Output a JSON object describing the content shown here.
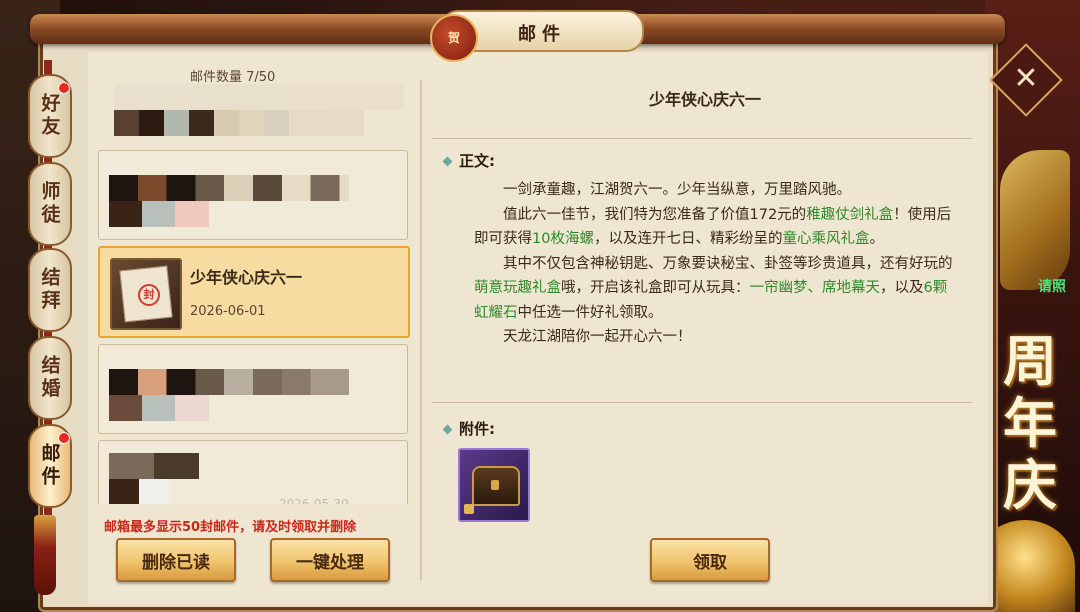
{
  "window": {
    "title": "邮件",
    "seal_text": "贺"
  },
  "scene": {
    "right_text": "请照",
    "anniversary_text": "周年庆"
  },
  "side_tabs": [
    {
      "label": "好友",
      "has_dot": true
    },
    {
      "label": "师徒",
      "has_dot": false
    },
    {
      "label": "结拜",
      "has_dot": false
    },
    {
      "label": "结婚",
      "has_dot": false
    },
    {
      "label": "邮件",
      "has_dot": true,
      "active": true
    }
  ],
  "mail_list": {
    "count_label": "邮件数量 7/50",
    "items": [
      {
        "title": "",
        "date": "",
        "blurred": true
      },
      {
        "title": "",
        "date": "",
        "blurred": true
      },
      {
        "title": "少年侠心庆六一",
        "date": "2026-06-01",
        "selected": true
      },
      {
        "title": "",
        "date": "",
        "blurred": true
      },
      {
        "title": "",
        "date": "2026-05-30",
        "blurred": true
      }
    ],
    "notice": "邮箱最多显示50封邮件，请及时领取并删除",
    "delete_read_label": "删除已读",
    "one_click_label": "一键处理"
  },
  "detail": {
    "title": "少年侠心庆六一",
    "body_label": "正文:",
    "paragraphs": [
      [
        {
          "t": "一剑承童趣，江湖贺六一。少年当纵意，万里踏风驰。"
        }
      ],
      [
        {
          "t": "值此六一佳节，我们特为您准备了价值172元的"
        },
        {
          "t": "稚趣仗剑礼盒",
          "g": true
        },
        {
          "t": "！使用后即可获得"
        },
        {
          "t": "10枚海螺",
          "g": true
        },
        {
          "t": "，以及连开七日、精彩纷呈的"
        },
        {
          "t": "童心乘风礼盒",
          "g": true
        },
        {
          "t": "。"
        }
      ],
      [
        {
          "t": "其中不仅包含神秘钥匙、万象要诀秘宝、卦签等珍贵道具，还有好玩的"
        },
        {
          "t": "萌意玩趣礼盒",
          "g": true
        },
        {
          "t": "哦，开启该礼盒即可从玩具："
        },
        {
          "t": "一帘幽梦、席地幕天",
          "g": true
        },
        {
          "t": "，以及"
        },
        {
          "t": "6颗虹耀石",
          "g": true
        },
        {
          "t": "中任选一件好礼领取。"
        }
      ],
      [
        {
          "t": "天龙江湖陪你一起开心六一！"
        }
      ]
    ],
    "attachment_label": "附件:",
    "claim_label": "领取"
  },
  "colors": {
    "highlight_green": "#2f8a2a",
    "notice_red": "#c8281a",
    "selected_border": "#e6a52a",
    "button_gold": "#f0c46e"
  }
}
